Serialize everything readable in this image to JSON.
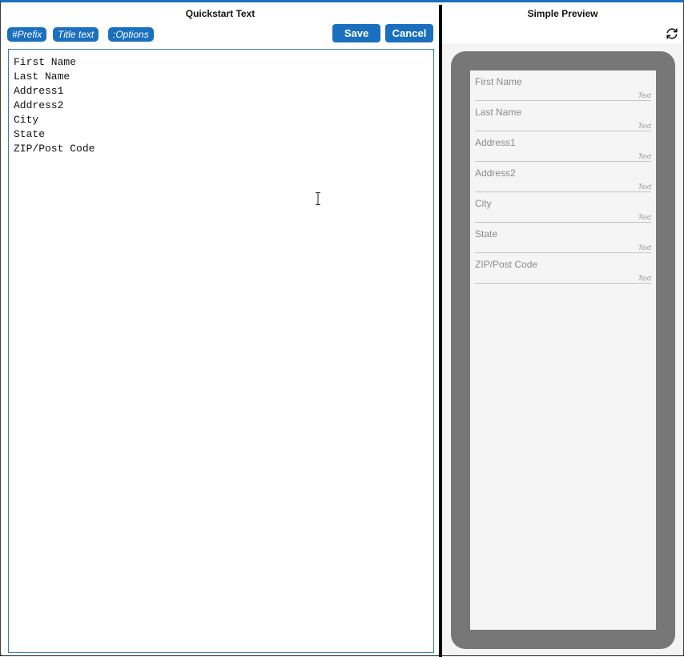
{
  "left_panel": {
    "title": "Quickstart Text",
    "tags": [
      "#Prefix",
      "Title text",
      ":Options"
    ],
    "save_label": "Save",
    "cancel_label": "Cancel",
    "editor_lines": [
      "First Name",
      "Last Name",
      "Address1",
      "Address2",
      "City",
      "State",
      "ZIP/Post Code"
    ]
  },
  "right_panel": {
    "title": "Simple Preview",
    "refresh_icon": "refresh-icon",
    "fields": [
      {
        "label": "First Name",
        "type": "Text"
      },
      {
        "label": "Last Name",
        "type": "Text"
      },
      {
        "label": "Address1",
        "type": "Text"
      },
      {
        "label": "Address2",
        "type": "Text"
      },
      {
        "label": "City",
        "type": "Text"
      },
      {
        "label": "State",
        "type": "Text"
      },
      {
        "label": "ZIP/Post Code",
        "type": "Text"
      }
    ]
  },
  "colors": {
    "accent": "#1a6fbf",
    "phone_frame": "#777777",
    "screen_bg": "#f5f5f5"
  }
}
